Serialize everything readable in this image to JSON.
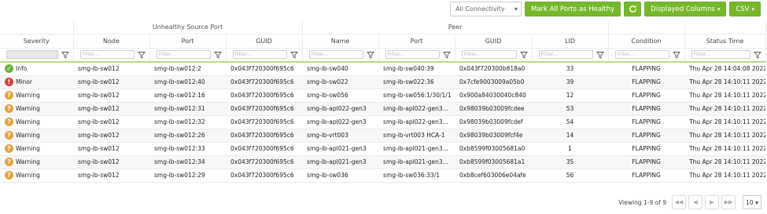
{
  "toolbar": {
    "connectivity_select": "All Connectivity",
    "mark_all_button": "Mark All Ports as Healthy",
    "displayed_columns_button": "Displayed Columns",
    "csv_button": "CSV"
  },
  "groups": {
    "unhealthy": "Unhealthy Source Port",
    "peer": "Peer"
  },
  "columns": [
    "Severity",
    "Node",
    "Port",
    "GUID",
    "Name",
    "Port",
    "GUID",
    "LID",
    "Condition",
    "Status Time"
  ],
  "filter_placeholder": "Filter...",
  "rows": [
    {
      "severity": "Info",
      "sev_class": "info",
      "node": "smg-ib-sw012",
      "port": "smg-ib-sw012:2",
      "guid": "0x043f720300f695c6",
      "name": "smg-ib-sw040",
      "peer_port": "smg-ib-sw040:39",
      "peer_guid": "0x043f720300b818a0",
      "lid": "33",
      "condition": "FLAPPING",
      "time": "Thu Apr 28 14:04:08 2022"
    },
    {
      "severity": "Minor",
      "sev_class": "minor",
      "node": "smg-ib-sw012",
      "port": "smg-ib-sw012:40",
      "guid": "0x043f720300f695c6",
      "name": "smg-ib-sw022",
      "peer_port": "smg-ib-sw022:36",
      "peer_guid": "0x7cfe9003009a05b0",
      "lid": "39",
      "condition": "FLAPPING",
      "time": "Thu Apr 28 14:10:11 2022"
    },
    {
      "severity": "Warning",
      "sev_class": "warning",
      "node": "smg-ib-sw012",
      "port": "smg-ib-sw012:16",
      "guid": "0x043f720300f695c6",
      "name": "smg-ib-sw056",
      "peer_port": "smg-ib-sw056:1/30/1/1",
      "peer_guid": "0x900a84030040c840",
      "lid": "12",
      "condition": "FLAPPING",
      "time": "Thu Apr 28 14:10:11 2022"
    },
    {
      "severity": "Warning",
      "sev_class": "warning",
      "node": "smg-ib-sw012",
      "port": "smg-ib-sw012:31",
      "guid": "0x043f720300f695c6",
      "name": "smg-ib-apl022-gen3",
      "peer_port": "smg-ib-apl022-gen3...",
      "peer_guid": "0x98039b03009fcdee",
      "lid": "53",
      "condition": "FLAPPING",
      "time": "Thu Apr 28 14:10:11 2022"
    },
    {
      "severity": "Warning",
      "sev_class": "warning",
      "node": "smg-ib-sw012",
      "port": "smg-ib-sw012:32",
      "guid": "0x043f720300f695c6",
      "name": "smg-ib-apl022-gen3",
      "peer_port": "smg-ib-apl022-gen3...",
      "peer_guid": "0x98039b03009fcdef",
      "lid": "54",
      "condition": "FLAPPING",
      "time": "Thu Apr 28 14:10:11 2022"
    },
    {
      "severity": "Warning",
      "sev_class": "warning",
      "node": "smg-ib-sw012",
      "port": "smg-ib-sw012:26",
      "guid": "0x043f720300f695c6",
      "name": "smg-ib-vrt003",
      "peer_port": "smg-ib-vrt003 HCA-1",
      "peer_guid": "0x98039b03009fcf4e",
      "lid": "14",
      "condition": "FLAPPING",
      "time": "Thu Apr 28 14:10:11 2022"
    },
    {
      "severity": "Warning",
      "sev_class": "warning",
      "node": "smg-ib-sw012",
      "port": "smg-ib-sw012:33",
      "guid": "0x043f720300f695c6",
      "name": "smg-ib-apl021-gen3",
      "peer_port": "smg-ib-apl021-gen3...",
      "peer_guid": "0xb8599f03005681a0",
      "lid": "1",
      "condition": "FLAPPING",
      "time": "Thu Apr 28 14:10:11 2022"
    },
    {
      "severity": "Warning",
      "sev_class": "warning",
      "node": "smg-ib-sw012",
      "port": "smg-ib-sw012:34",
      "guid": "0x043f720300f695c6",
      "name": "smg-ib-apl021-gen3",
      "peer_port": "smg-ib-apl021-gen3...",
      "peer_guid": "0xb8599f03005681a1",
      "lid": "35",
      "condition": "FLAPPING",
      "time": "Thu Apr 28 14:10:11 2022"
    },
    {
      "severity": "Warning",
      "sev_class": "warning",
      "node": "smg-ib-sw012",
      "port": "smg-ib-sw012:29",
      "guid": "0x043f720300f695c6",
      "name": "smg-ib-sw036",
      "peer_port": "smg-ib-sw036:33/1",
      "peer_guid": "0xb8cef603006e04afe",
      "lid": "56",
      "condition": "FLAPPING",
      "time": "Thu Apr 28 14:10:11 2022"
    }
  ],
  "footer": {
    "viewing": "Viewing 1-9 of 9",
    "page_size": "10"
  }
}
